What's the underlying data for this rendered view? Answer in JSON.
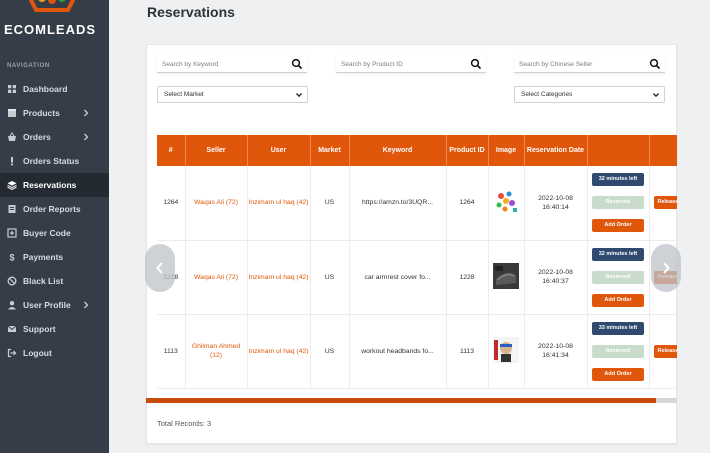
{
  "brand": {
    "name": "ECOMLEADS"
  },
  "sidebar": {
    "heading": "NAVIGATION",
    "items": [
      {
        "label": "Dashboard",
        "icon": "grid-icon",
        "chevron": false,
        "active": false
      },
      {
        "label": "Products",
        "icon": "box-icon",
        "chevron": true,
        "active": false
      },
      {
        "label": "Orders",
        "icon": "basket-icon",
        "chevron": true,
        "active": false
      },
      {
        "label": "Orders Status",
        "icon": "exclamation-icon",
        "chevron": false,
        "active": false
      },
      {
        "label": "Reservations",
        "icon": "layers-icon",
        "chevron": false,
        "active": true
      },
      {
        "label": "Order Reports",
        "icon": "report-icon",
        "chevron": false,
        "active": false
      },
      {
        "label": "Buyer Code",
        "icon": "plus-square-icon",
        "chevron": false,
        "active": false
      },
      {
        "label": "Payments",
        "icon": "dollar-icon",
        "chevron": false,
        "active": false
      },
      {
        "label": "Black List",
        "icon": "ban-icon",
        "chevron": false,
        "active": false
      },
      {
        "label": "User Profile",
        "icon": "user-icon",
        "chevron": true,
        "active": false
      },
      {
        "label": "Support",
        "icon": "envelope-icon",
        "chevron": false,
        "active": false
      },
      {
        "label": "Logout",
        "icon": "logout-icon",
        "chevron": false,
        "active": false
      }
    ]
  },
  "page": {
    "title": "Reservations"
  },
  "filters": {
    "keyword_placeholder": "Search by Keyword",
    "product_placeholder": "Search by Product ID",
    "seller_placeholder": "Search by Chinese Seller",
    "market_select": "Select Market",
    "category_select": "Select Categories"
  },
  "table": {
    "headers": [
      "#",
      "Seller",
      "User",
      "Market",
      "Keyword",
      "Product ID",
      "Image",
      "Reservation Date",
      "",
      ""
    ],
    "rows": [
      {
        "id": "1264",
        "seller": "Waqas Ali (72)",
        "user": "Inzimam ul haq (42)",
        "market": "US",
        "keyword": "https://amzn.to/3UQR...",
        "product_id": "1264",
        "image": "colorful-items-thumbnail",
        "date": "2022-10-08 16:40:14",
        "timer": "32 minutes left",
        "status": "Reserved",
        "add": "Add Order",
        "release": "Release"
      },
      {
        "id": "1228",
        "seller": "Waqas Ali (72)",
        "user": "Inzimam ul haq (42)",
        "market": "US",
        "keyword": "car armrest cover fo...",
        "product_id": "1228",
        "image": "car-armrest-thumbnail",
        "date": "2022-10-08 16:40:37",
        "timer": "32 minutes left",
        "status": "Reserved",
        "add": "Add Order",
        "release": "Release"
      },
      {
        "id": "1113",
        "seller": "Ghilman Ahmed (12)",
        "user": "Inzimam ul haq (42)",
        "market": "US",
        "keyword": "workout headbands fo...",
        "product_id": "1113",
        "image": "headband-thumbnail",
        "date": "2022-10-08 16:41:34",
        "timer": "33 minutes left",
        "status": "Reserved",
        "add": "Add Order",
        "release": "Release"
      }
    ]
  },
  "footer": {
    "total": "Total Records: 3"
  },
  "colors": {
    "accent": "#e0560b",
    "sidebar": "#353d48",
    "timer": "#2f4a6e",
    "reserved": "#c9dccb"
  }
}
